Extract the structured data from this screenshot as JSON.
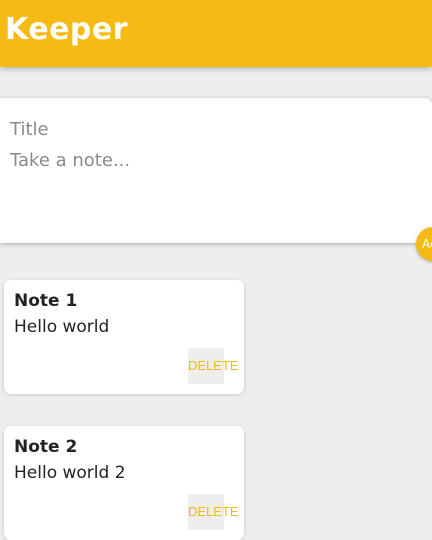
{
  "header": {
    "title": "Keeper"
  },
  "composer": {
    "title_placeholder": "Title",
    "content_placeholder": "Take a note...",
    "add_button_label": "Add"
  },
  "notes": [
    {
      "title": "Note 1",
      "content": "Hello world",
      "delete_label": "DELETE"
    },
    {
      "title": "Note 2",
      "content": "Hello world 2",
      "delete_label": "DELETE"
    }
  ],
  "colors": {
    "accent": "#f5ba13",
    "background": "#eeeeee",
    "card": "#ffffff"
  }
}
